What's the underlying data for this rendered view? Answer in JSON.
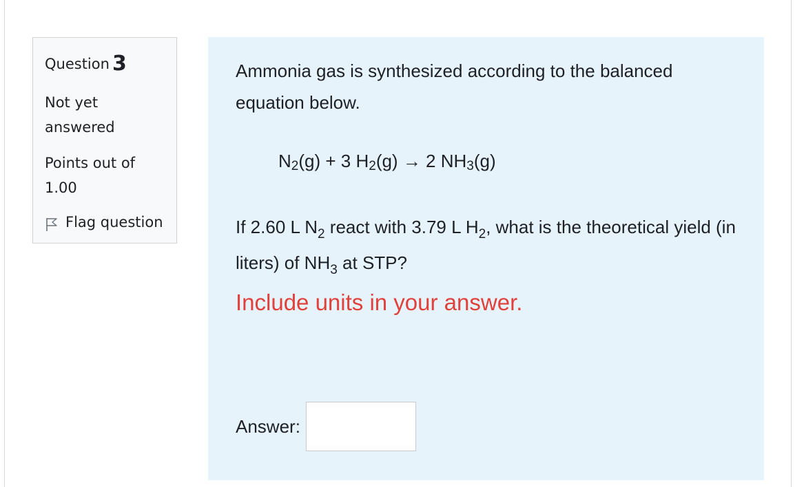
{
  "info": {
    "question_prefix": "Question",
    "question_number": "3",
    "state_line1": "Not yet",
    "state_line2": "answered",
    "grade_line1": "Points out of",
    "grade_line2": "1.00",
    "flag_label": "Flag question"
  },
  "question": {
    "intro": "Ammonia gas is synthesized according to the balanced equation below.",
    "equation": {
      "n": "N",
      "sub1": "2",
      "part2": "(g) + 3 H",
      "sub2": "2",
      "part3": "(g) → 2 NH",
      "sub3": "3",
      "part4": "(g)"
    },
    "prompt": {
      "p1": "If 2.60 L N",
      "s1": "2",
      "p2": " react with 3.79 L H",
      "s2": "2",
      "p3": ", what is the theoretical yield (in liters) of NH",
      "s3": "3",
      "p4": " at STP?"
    },
    "note": "Include units in your answer.",
    "note_color": "#e0413c",
    "answer_label": "Answer:",
    "answer_value": ""
  }
}
